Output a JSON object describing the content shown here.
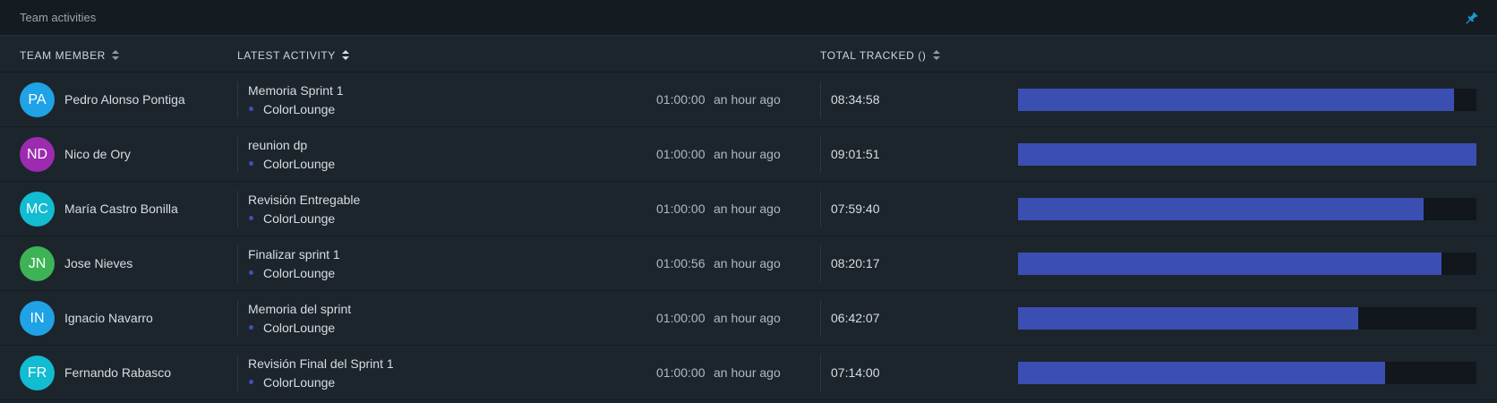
{
  "panel": {
    "title": "Team activities",
    "pin_icon": "pin-icon"
  },
  "columns": {
    "member": "TEAM MEMBER",
    "activity": "LATEST ACTIVITY",
    "total": "TOTAL TRACKED ()"
  },
  "colors": {
    "bar": "#3b4fb3",
    "dot": "#3f51b5",
    "pin": "#1e9bd7"
  },
  "rows": [
    {
      "initials": "PA",
      "avatar_color": "#1fa2e6",
      "name": "Pedro Alonso Pontiga",
      "activity": "Memoria Sprint 1",
      "project": "ColorLounge",
      "duration": "01:00:00",
      "ago": "an hour ago",
      "total": "08:34:58",
      "progress": 0.951
    },
    {
      "initials": "ND",
      "avatar_color": "#9c2bb0",
      "name": "Nico de Ory",
      "activity": "reunion dp",
      "project": "ColorLounge",
      "duration": "01:00:00",
      "ago": "an hour ago",
      "total": "09:01:51",
      "progress": 1.0
    },
    {
      "initials": "MC",
      "avatar_color": "#12bcd1",
      "name": "María Castro Bonilla",
      "activity": "Revisión Entregable",
      "project": "ColorLounge",
      "duration": "01:00:00",
      "ago": "an hour ago",
      "total": "07:59:40",
      "progress": 0.885
    },
    {
      "initials": "JN",
      "avatar_color": "#3eb356",
      "name": "Jose Nieves",
      "activity": "Finalizar sprint 1",
      "project": "ColorLounge",
      "duration": "01:00:56",
      "ago": "an hour ago",
      "total": "08:20:17",
      "progress": 0.923
    },
    {
      "initials": "IN",
      "avatar_color": "#1fa2e6",
      "name": "Ignacio Navarro",
      "activity": "Memoria del sprint",
      "project": "ColorLounge",
      "duration": "01:00:00",
      "ago": "an hour ago",
      "total": "06:42:07",
      "progress": 0.742
    },
    {
      "initials": "FR",
      "avatar_color": "#12bcd1",
      "name": "Fernando Rabasco",
      "activity": "Revisión Final del Sprint 1",
      "project": "ColorLounge",
      "duration": "01:00:00",
      "ago": "an hour ago",
      "total": "07:14:00",
      "progress": 0.801
    }
  ]
}
